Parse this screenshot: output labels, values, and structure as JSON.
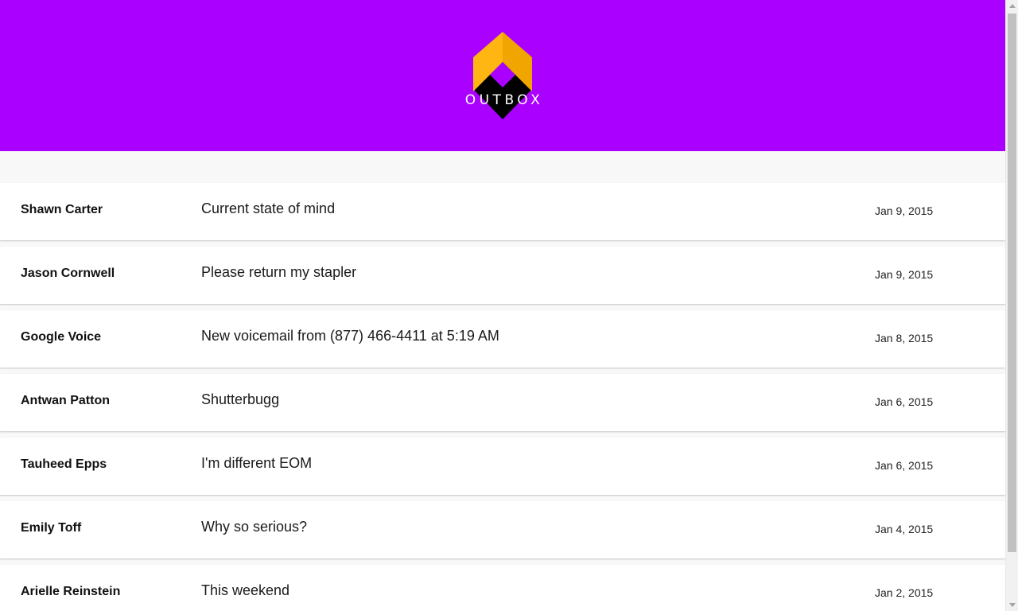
{
  "header": {
    "background_color": "#aa00ff",
    "logo": {
      "text": "OUTBOX",
      "icon": "outbox-logo-icon",
      "colors": {
        "left_face": "#ffb612",
        "right_face": "#f0a500",
        "bottom": "#000000"
      }
    }
  },
  "messages": [
    {
      "sender": "Shawn Carter",
      "subject": "Current state of mind",
      "date": "Jan 9, 2015"
    },
    {
      "sender": "Jason Cornwell",
      "subject": "Please return my stapler",
      "date": "Jan 9, 2015"
    },
    {
      "sender": "Google Voice",
      "subject": "New voicemail from (877) 466-4411 at 5:19 AM",
      "date": "Jan 8, 2015"
    },
    {
      "sender": "Antwan Patton",
      "subject": "Shutterbugg",
      "date": "Jan 6, 2015"
    },
    {
      "sender": "Tauheed Epps",
      "subject": "I'm different EOM",
      "date": "Jan 6, 2015"
    },
    {
      "sender": "Emily Toff",
      "subject": "Why so serious?",
      "date": "Jan 4, 2015"
    },
    {
      "sender": "Arielle Reinstein",
      "subject": "This weekend",
      "date": "Jan 2, 2015"
    }
  ]
}
